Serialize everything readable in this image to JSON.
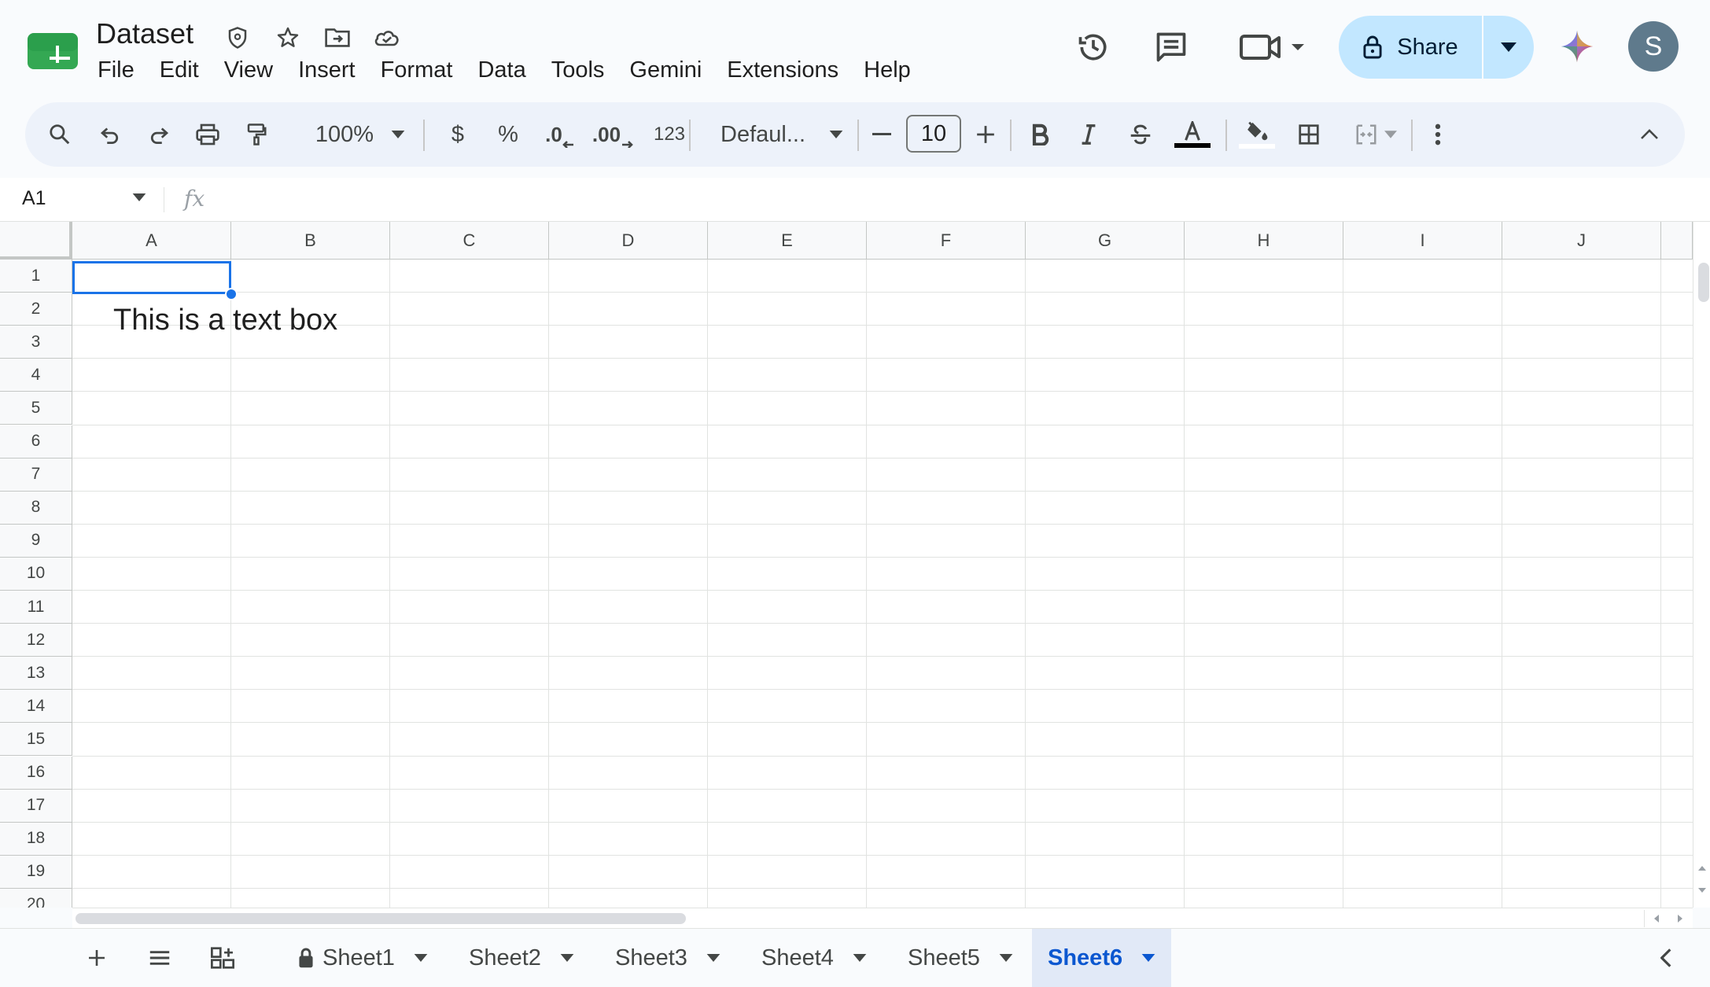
{
  "document": {
    "title": "Dataset",
    "title_icons": [
      "security-shield-icon",
      "star-icon",
      "move-folder-icon",
      "cloud-status-icon"
    ]
  },
  "menu": [
    "File",
    "Edit",
    "View",
    "Insert",
    "Format",
    "Data",
    "Tools",
    "Gemini",
    "Extensions",
    "Help"
  ],
  "header": {
    "share_label": "Share",
    "avatar_letter": "S",
    "icons": [
      "version-history-icon",
      "comments-icon",
      "meet-camera-icon",
      "gemini-icon"
    ]
  },
  "toolbar": {
    "zoom": "100%",
    "currency": "$",
    "percent": "%",
    "decrease_decimal": ".0",
    "increase_decimal": ".00",
    "number_format": "123",
    "font_family": "Defaul...",
    "font_size": "10"
  },
  "formula_bar": {
    "cell_ref": "A1",
    "fx": "fx",
    "value": ""
  },
  "grid": {
    "columns": [
      "A",
      "B",
      "C",
      "D",
      "E",
      "F",
      "G",
      "H",
      "I",
      "J"
    ],
    "rows": [
      "1",
      "2",
      "3",
      "4",
      "5",
      "6",
      "7",
      "8",
      "9",
      "10",
      "11",
      "12",
      "13",
      "14",
      "15",
      "16",
      "17",
      "18",
      "19",
      "20"
    ],
    "selected_cell": "A1",
    "text_box": "This is a text box"
  },
  "sheets": {
    "tabs": [
      {
        "label": "Sheet1",
        "locked": true,
        "active": false
      },
      {
        "label": "Sheet2",
        "locked": false,
        "active": false
      },
      {
        "label": "Sheet3",
        "locked": false,
        "active": false
      },
      {
        "label": "Sheet4",
        "locked": false,
        "active": false
      },
      {
        "label": "Sheet5",
        "locked": false,
        "active": false
      },
      {
        "label": "Sheet6",
        "locked": false,
        "active": true
      }
    ]
  },
  "colors": {
    "accent": "#0b57d0",
    "selection": "#1a73e8",
    "share_bg": "#c2e7ff",
    "toolbar_bg": "#edf2fa",
    "active_tab_bg": "#e1e9f7"
  }
}
